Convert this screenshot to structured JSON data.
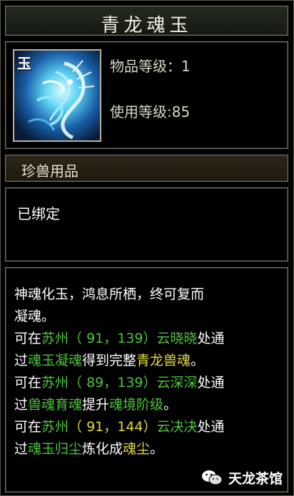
{
  "tooltip": {
    "title": "青龙魂玉",
    "icon": {
      "name": "dragon-soul-jade-icon",
      "tag": "玉"
    },
    "level_label": "物品等级",
    "level_value": "1",
    "use_level_label": "使用等级",
    "use_level_value": "85",
    "category": "珍兽用品",
    "bound_status": "已绑定",
    "description": {
      "line1": "神魂化玉，鸿息所栖，终可复而",
      "line2": "凝魂。",
      "s1": {
        "pre": "可在",
        "city": "苏州",
        "coords": "（ 91，139）",
        "npc": "云晓晓",
        "mid": "处通",
        "pre2": "过",
        "item": "魂玉凝魂",
        "verb": "得到完整",
        "result": "青龙兽魂",
        "end": "。"
      },
      "s2": {
        "pre": "可在",
        "city": "苏州",
        "coords": "（ 89，139）",
        "npc": "云深深",
        "mid": "处通",
        "pre2": "过",
        "item": "兽魂育魂",
        "verb": "提升",
        "result": "魂境阶级",
        "end": "。"
      },
      "s3": {
        "pre": "可在",
        "city": "苏州",
        "coords": "（ 91，144）",
        "npc": "云决决",
        "mid": "处通",
        "pre2": "过",
        "item": "魂玉归尘",
        "verb": "炼化成",
        "result": "魂尘",
        "end": "。"
      }
    }
  },
  "watermark": {
    "text": "天龙茶馆",
    "icon": "wechat-icon"
  },
  "colors": {
    "green": "#4cc63b",
    "yellow": "#e6dc3c",
    "border": "#7d7b66"
  }
}
